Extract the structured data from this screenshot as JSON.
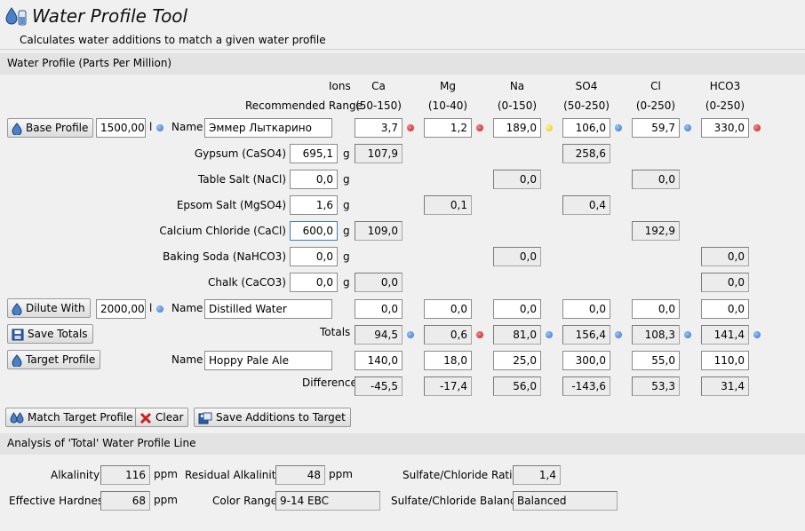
{
  "app": {
    "title": "Water Profile Tool",
    "subtitle": "Calculates water additions to match a given water profile"
  },
  "profile_section": {
    "label": "Water Profile (Parts Per Million)",
    "ions_label": "Ions",
    "recommended_label": "Recommended Range",
    "ions": [
      "Ca",
      "Mg",
      "Na",
      "SO4",
      "Cl",
      "HCO3"
    ],
    "ranges": [
      "(50-150)",
      "(10-40)",
      "(0-150)",
      "(50-250)",
      "(0-250)",
      "(0-250)"
    ]
  },
  "base": {
    "button": "Base Profile",
    "volume": "1500,00",
    "unit": "l",
    "name_label": "Name",
    "name": "Эммер Лыткарино",
    "values": [
      "3,7",
      "1,2",
      "189,0",
      "106,0",
      "59,7",
      "330,0"
    ],
    "indicators": [
      "red",
      "red",
      "yellow",
      "blue",
      "blue",
      "red"
    ]
  },
  "additions": [
    {
      "label": "Gypsum (CaSO4)",
      "amount": "695,1",
      "unit": "g",
      "results": [
        "107,9",
        "",
        "",
        "258,6",
        "",
        ""
      ]
    },
    {
      "label": "Table Salt (NaCl)",
      "amount": "0,0",
      "unit": "g",
      "results": [
        "",
        "",
        "0,0",
        "",
        "0,0",
        ""
      ]
    },
    {
      "label": "Epsom Salt (MgSO4)",
      "amount": "1,6",
      "unit": "g",
      "results": [
        "",
        "0,1",
        "",
        "0,4",
        "",
        ""
      ]
    },
    {
      "label": "Calcium Chloride (CaCl)",
      "amount": "600,0",
      "unit": "g",
      "results": [
        "109,0",
        "",
        "",
        "",
        "192,9",
        ""
      ]
    },
    {
      "label": "Baking Soda (NaHCO3)",
      "amount": "0,0",
      "unit": "g",
      "results": [
        "",
        "",
        "0,0",
        "",
        "",
        "0,0"
      ]
    },
    {
      "label": "Chalk (CaCO3)",
      "amount": "0,0",
      "unit": "g",
      "results": [
        "0,0",
        "",
        "",
        "",
        "",
        "0,0"
      ]
    }
  ],
  "dilute": {
    "button": "Dilute With",
    "volume": "2000,00",
    "unit": "l",
    "name_label": "Name",
    "name": "Distilled Water",
    "values": [
      "0,0",
      "0,0",
      "0,0",
      "0,0",
      "0,0",
      "0,0"
    ]
  },
  "totals": {
    "button": "Save Totals",
    "label": "Totals",
    "values": [
      "94,5",
      "0,6",
      "81,0",
      "156,4",
      "108,3",
      "141,4"
    ],
    "indicators": [
      "blue",
      "red",
      "blue",
      "blue",
      "blue",
      "blue"
    ]
  },
  "target": {
    "button": "Target Profile",
    "name_label": "Name",
    "name": "Hoppy Pale Ale",
    "values": [
      "140,0",
      "18,0",
      "25,0",
      "300,0",
      "55,0",
      "110,0"
    ]
  },
  "difference": {
    "label": "Difference",
    "values": [
      "-45,5",
      "-17,4",
      "56,0",
      "-143,6",
      "53,3",
      "31,4"
    ]
  },
  "actions": {
    "match": "Match Target Profile",
    "clear": "Clear",
    "save_additions": "Save Additions to Target"
  },
  "analysis": {
    "header": "Analysis of 'Total' Water Profile Line",
    "alkalinity_label": "Alkalinity",
    "alkalinity": "116",
    "ppm": "ppm",
    "residual_label": "Residual Alkalinity",
    "residual": "48",
    "ratio_label": "Sulfate/Chloride Ratio",
    "ratio": "1,4",
    "hardness_label": "Effective Hardness",
    "hardness": "68",
    "color_label": "Color Range",
    "color": "9-14 EBC",
    "balance_label": "Sulfate/Chloride Balance",
    "balance": "Balanced"
  },
  "colors": {
    "blue": "#2f6fd0",
    "red": "#c71414",
    "yellow": "#e0c400",
    "accent": "#3c7fb1"
  }
}
